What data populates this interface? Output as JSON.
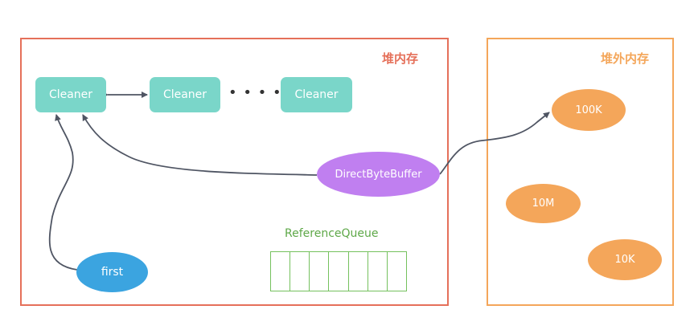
{
  "heap": {
    "title": "堆内存"
  },
  "offheap": {
    "title": "堆外内存"
  },
  "cleaners": [
    "Cleaner",
    "Cleaner",
    "Cleaner"
  ],
  "ellipsis": "• • • • • •",
  "direct_byte_buffer": "DirectByteBuffer",
  "first": "first",
  "reference_queue": {
    "label": "ReferenceQueue",
    "cells": 7
  },
  "memory_blocks": [
    "100K",
    "10M",
    "10K"
  ],
  "colors": {
    "heap_border": "#e5705a",
    "offheap_border": "#f4a65a",
    "cleaner": "#7ad6c9",
    "direct_byte_buffer": "#c07ff0",
    "first": "#3ba4e0",
    "memory_block": "#f4a65a",
    "reference_queue": "#75c15e",
    "arrow": "#4f5563"
  }
}
